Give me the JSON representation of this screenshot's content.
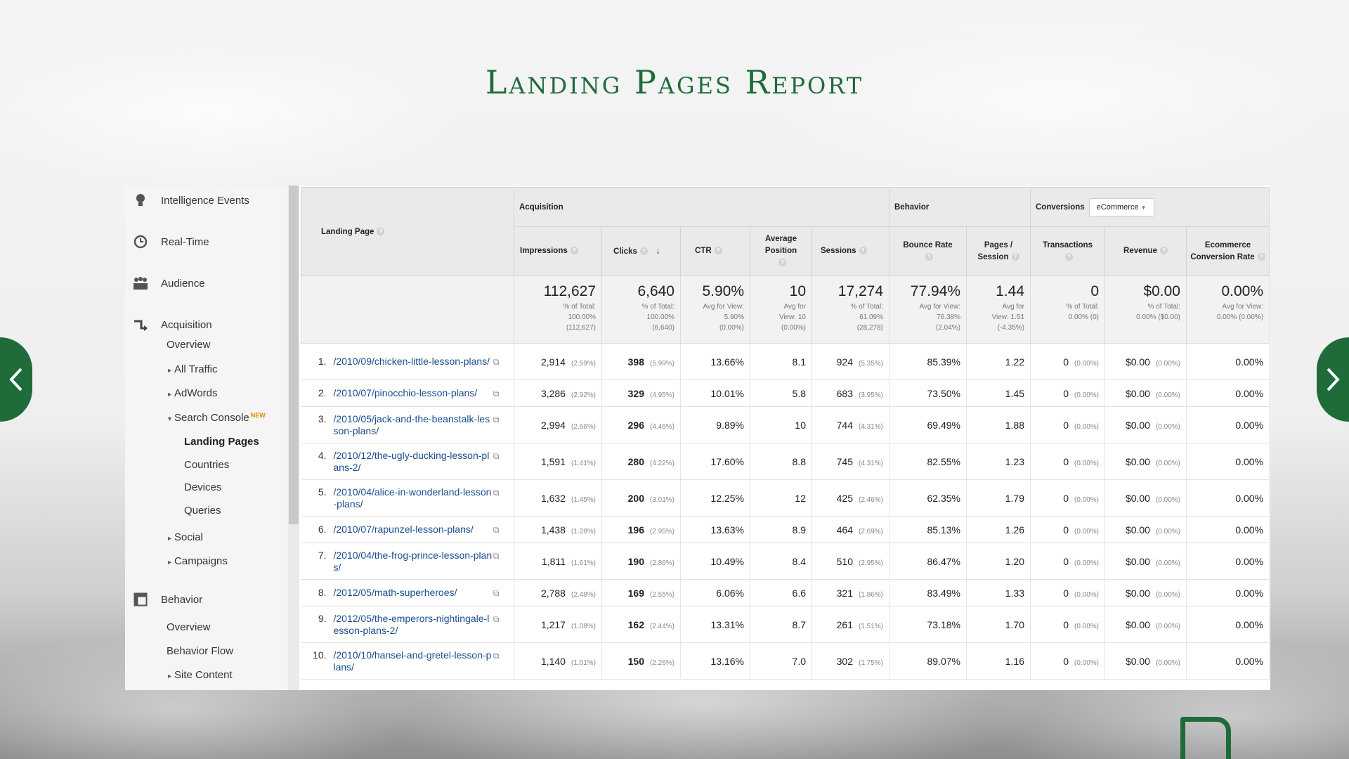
{
  "slide": {
    "title": "Landing Pages Report"
  },
  "sidebar": {
    "sections": [
      {
        "label": "Intelligence Events",
        "icon": "lightbulb-icon"
      },
      {
        "label": "Real-Time",
        "icon": "clock-icon"
      },
      {
        "label": "Audience",
        "icon": "people-icon"
      },
      {
        "label": "Acquisition",
        "icon": "acquisition-icon"
      },
      {
        "label": "Behavior",
        "icon": "behavior-icon"
      }
    ],
    "acq_items": {
      "overview": "Overview",
      "all_traffic": "All Traffic",
      "adwords": "AdWords",
      "search_console": "Search Console",
      "new_badge": "NEW",
      "landing_pages": "Landing Pages",
      "countries": "Countries",
      "devices": "Devices",
      "queries": "Queries",
      "social": "Social",
      "campaigns": "Campaigns"
    },
    "beh_items": {
      "overview": "Overview",
      "behavior_flow": "Behavior Flow",
      "site_content": "Site Content"
    }
  },
  "table": {
    "groups": {
      "acquisition": "Acquisition",
      "behavior": "Behavior",
      "conversions": "Conversions",
      "conversions_select": "eCommerce"
    },
    "columns": {
      "landing_page": "Landing Page",
      "impressions": "Impressions",
      "clicks": "Clicks",
      "ctr": "CTR",
      "avg_position": "Average Position",
      "sessions": "Sessions",
      "bounce_rate": "Bounce Rate",
      "pages_session": "Pages / Session",
      "transactions": "Transactions",
      "revenue": "Revenue",
      "ecom_rate": "Ecommerce Conversion Rate"
    },
    "totals": {
      "impressions": {
        "value": "112,627",
        "l1": "% of Total:",
        "l2": "100.00%",
        "l3": "(112,627)"
      },
      "clicks": {
        "value": "6,640",
        "l1": "% of Total:",
        "l2": "100.00%",
        "l3": "(6,640)"
      },
      "ctr": {
        "value": "5.90%",
        "l1": "Avg for View:",
        "l2": "5.90%",
        "l3": "(0.00%)"
      },
      "avg_position": {
        "value": "10",
        "l1": "Avg for",
        "l2": "View: 10",
        "l3": "(0.00%)"
      },
      "sessions": {
        "value": "17,274",
        "l1": "% of Total:",
        "l2": "61.09%",
        "l3": "(28,278)"
      },
      "bounce_rate": {
        "value": "77.94%",
        "l1": "Avg for View:",
        "l2": "76.38%",
        "l3": "(2.04%)"
      },
      "pages_session": {
        "value": "1.44",
        "l1": "Avg for",
        "l2": "View: 1.51",
        "l3": "(-4.35%)"
      },
      "transactions": {
        "value": "0",
        "l1": "% of Total:",
        "l2": "0.00% (0)",
        "l3": ""
      },
      "revenue": {
        "value": "$0.00",
        "l1": "% of Total:",
        "l2": "0.00% ($0.00)",
        "l3": ""
      },
      "ecom_rate": {
        "value": "0.00%",
        "l1": "Avg for View:",
        "l2": "0.00% (0.00%)",
        "l3": ""
      }
    },
    "rows": [
      {
        "num": "1.",
        "page": "/2010/09/chicken-little-lesson-plans/",
        "impressions": "2,914",
        "imp_pct": "(2.59%)",
        "clicks": "398",
        "clk_pct": "(5.99%)",
        "ctr": "13.66%",
        "pos": "8.1",
        "sessions": "924",
        "ses_pct": "(5.35%)",
        "bounce": "85.39%",
        "pps": "1.22",
        "trans": "0",
        "trans_pct": "(0.00%)",
        "rev": "$0.00",
        "rev_pct": "(0.00%)",
        "ecr": "0.00%"
      },
      {
        "num": "2.",
        "page": "/2010/07/pinocchio-lesson-plans/",
        "impressions": "3,286",
        "imp_pct": "(2.92%)",
        "clicks": "329",
        "clk_pct": "(4.95%)",
        "ctr": "10.01%",
        "pos": "5.8",
        "sessions": "683",
        "ses_pct": "(3.95%)",
        "bounce": "73.50%",
        "pps": "1.45",
        "trans": "0",
        "trans_pct": "(0.00%)",
        "rev": "$0.00",
        "rev_pct": "(0.00%)",
        "ecr": "0.00%"
      },
      {
        "num": "3.",
        "page": "/2010/05/jack-and-the-beanstalk-lesson-plans/",
        "impressions": "2,994",
        "imp_pct": "(2.66%)",
        "clicks": "296",
        "clk_pct": "(4.46%)",
        "ctr": "9.89%",
        "pos": "10",
        "sessions": "744",
        "ses_pct": "(4.31%)",
        "bounce": "69.49%",
        "pps": "1.88",
        "trans": "0",
        "trans_pct": "(0.00%)",
        "rev": "$0.00",
        "rev_pct": "(0.00%)",
        "ecr": "0.00%"
      },
      {
        "num": "4.",
        "page": "/2010/12/the-ugly-ducking-lesson-plans-2/",
        "impressions": "1,591",
        "imp_pct": "(1.41%)",
        "clicks": "280",
        "clk_pct": "(4.22%)",
        "ctr": "17.60%",
        "pos": "8.8",
        "sessions": "745",
        "ses_pct": "(4.31%)",
        "bounce": "82.55%",
        "pps": "1.23",
        "trans": "0",
        "trans_pct": "(0.00%)",
        "rev": "$0.00",
        "rev_pct": "(0.00%)",
        "ecr": "0.00%"
      },
      {
        "num": "5.",
        "page": "/2010/04/alice-in-wonderland-lesson-plans/",
        "impressions": "1,632",
        "imp_pct": "(1.45%)",
        "clicks": "200",
        "clk_pct": "(3.01%)",
        "ctr": "12.25%",
        "pos": "12",
        "sessions": "425",
        "ses_pct": "(2.46%)",
        "bounce": "62.35%",
        "pps": "1.79",
        "trans": "0",
        "trans_pct": "(0.00%)",
        "rev": "$0.00",
        "rev_pct": "(0.00%)",
        "ecr": "0.00%"
      },
      {
        "num": "6.",
        "page": "/2010/07/rapunzel-lesson-plans/",
        "impressions": "1,438",
        "imp_pct": "(1.28%)",
        "clicks": "196",
        "clk_pct": "(2.95%)",
        "ctr": "13.63%",
        "pos": "8.9",
        "sessions": "464",
        "ses_pct": "(2.69%)",
        "bounce": "85.13%",
        "pps": "1.26",
        "trans": "0",
        "trans_pct": "(0.00%)",
        "rev": "$0.00",
        "rev_pct": "(0.00%)",
        "ecr": "0.00%"
      },
      {
        "num": "7.",
        "page": "/2010/04/the-frog-prince-lesson-plans/",
        "impressions": "1,811",
        "imp_pct": "(1.61%)",
        "clicks": "190",
        "clk_pct": "(2.86%)",
        "ctr": "10.49%",
        "pos": "8.4",
        "sessions": "510",
        "ses_pct": "(2.95%)",
        "bounce": "86.47%",
        "pps": "1.20",
        "trans": "0",
        "trans_pct": "(0.00%)",
        "rev": "$0.00",
        "rev_pct": "(0.00%)",
        "ecr": "0.00%"
      },
      {
        "num": "8.",
        "page": "/2012/05/math-superheroes/",
        "impressions": "2,788",
        "imp_pct": "(2.48%)",
        "clicks": "169",
        "clk_pct": "(2.55%)",
        "ctr": "6.06%",
        "pos": "6.6",
        "sessions": "321",
        "ses_pct": "(1.86%)",
        "bounce": "83.49%",
        "pps": "1.33",
        "trans": "0",
        "trans_pct": "(0.00%)",
        "rev": "$0.00",
        "rev_pct": "(0.00%)",
        "ecr": "0.00%"
      },
      {
        "num": "9.",
        "page": "/2012/05/the-emperors-nightingale-lesson-plans-2/",
        "impressions": "1,217",
        "imp_pct": "(1.08%)",
        "clicks": "162",
        "clk_pct": "(2.44%)",
        "ctr": "13.31%",
        "pos": "8.7",
        "sessions": "261",
        "ses_pct": "(1.51%)",
        "bounce": "73.18%",
        "pps": "1.70",
        "trans": "0",
        "trans_pct": "(0.00%)",
        "rev": "$0.00",
        "rev_pct": "(0.00%)",
        "ecr": "0.00%"
      },
      {
        "num": "10.",
        "page": "/2010/10/hansel-and-gretel-lesson-plans/",
        "impressions": "1,140",
        "imp_pct": "(1.01%)",
        "clicks": "150",
        "clk_pct": "(2.26%)",
        "ctr": "13.16%",
        "pos": "7.0",
        "sessions": "302",
        "ses_pct": "(1.75%)",
        "bounce": "89.07%",
        "pps": "1.16",
        "trans": "0",
        "trans_pct": "(0.00%)",
        "rev": "$0.00",
        "rev_pct": "(0.00%)",
        "ecr": "0.00%"
      }
    ]
  },
  "colors": {
    "brand_green": "#1f6b3a",
    "link_blue": "#1a4d8f",
    "new_badge": "#e08a00"
  }
}
